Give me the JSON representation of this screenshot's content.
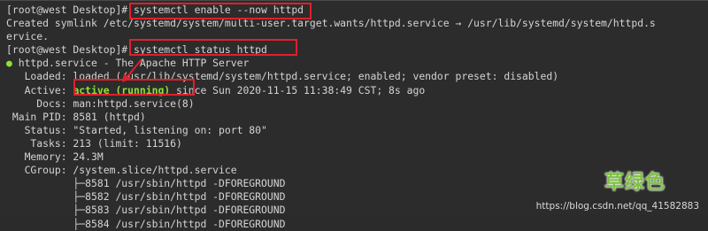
{
  "terminal": {
    "lines": [
      {
        "segments": [
          {
            "text": "[root@west Desktop]# "
          },
          {
            "text": "systemctl enable --now httpd"
          }
        ]
      },
      {
        "segments": [
          {
            "text": "Created symlink /etc/systemd/system/multi-user.target.wants/httpd.service → /usr/lib/systemd/system/httpd.s"
          }
        ]
      },
      {
        "segments": [
          {
            "text": "ervice."
          }
        ]
      },
      {
        "segments": [
          {
            "text": "[root@west Desktop]# "
          },
          {
            "text": "systemctl status httpd"
          }
        ]
      },
      {
        "segments": [
          {
            "text": "●",
            "style": "green"
          },
          {
            "text": " httpd.service - The Apache HTTP Server"
          }
        ]
      },
      {
        "segments": [
          {
            "text": "   Loaded: loaded (/usr/lib/systemd/system/httpd.service; enabled; vendor preset: disabled)"
          }
        ]
      },
      {
        "segments": [
          {
            "text": "   Active: "
          },
          {
            "text": "active (running)",
            "style": "bold-green"
          },
          {
            "text": " since Sun 2020-11-15 11:38:49 CST; 8s ago"
          }
        ]
      },
      {
        "segments": [
          {
            "text": "     Docs: man:httpd.service(8)"
          }
        ]
      },
      {
        "segments": [
          {
            "text": " Main PID: 8581 (httpd)"
          }
        ]
      },
      {
        "segments": [
          {
            "text": "   Status: \"Started, listening on: port 80\""
          }
        ]
      },
      {
        "segments": [
          {
            "text": "    Tasks: 213 (limit: 11516)"
          }
        ]
      },
      {
        "segments": [
          {
            "text": "   Memory: 24.3M"
          }
        ]
      },
      {
        "segments": [
          {
            "text": "   CGroup: /system.slice/httpd.service"
          }
        ]
      },
      {
        "segments": [
          {
            "text": "           ├─8581 /usr/sbin/httpd -DFOREGROUND"
          }
        ]
      },
      {
        "segments": [
          {
            "text": "           ├─8582 /usr/sbin/httpd -DFOREGROUND"
          }
        ]
      },
      {
        "segments": [
          {
            "text": "           ├─8583 /usr/sbin/httpd -DFOREGROUND"
          }
        ]
      },
      {
        "segments": [
          {
            "text": "           ├─8584 /usr/sbin/httpd -DFOREGROUND"
          }
        ]
      }
    ]
  },
  "watermark": {
    "brand": "草绿色",
    "url": "https://blog.csdn.net/qq_41582883"
  },
  "colors": {
    "background": "#2c2c2c",
    "text": "#d4d4d4",
    "running": "#8ae234",
    "highlight_box": "#e0202a"
  }
}
